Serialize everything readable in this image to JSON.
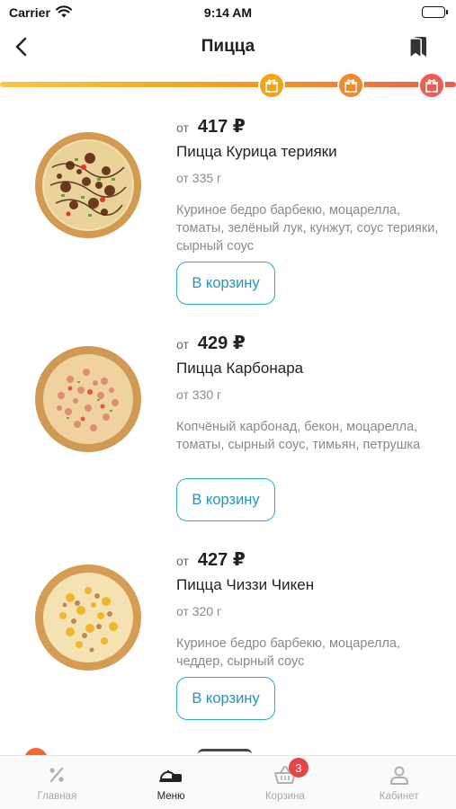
{
  "status_bar": {
    "carrier": "Carrier",
    "time": "9:14 AM"
  },
  "nav": {
    "title": "Пицца",
    "back_icon": "chevron-left-icon",
    "bookmark_icon": "bookmark-icon"
  },
  "gift_progress": {
    "gift_icon": "gift-icon",
    "colors": [
      "#f5a21b",
      "#f2892a",
      "#ee5d52"
    ]
  },
  "products": [
    {
      "price_prefix": "от",
      "price": "417 ₽",
      "name": "Пицца Курица терияки",
      "weight": "от 335 г",
      "ingredients": "Куриное бедро барбекю, моцарелла, томаты, зелёный лук, кунжут, соус терияки, сырный соус",
      "button": "В корзину"
    },
    {
      "price_prefix": "от",
      "price": "429 ₽",
      "name": "Пицца Карбонара",
      "weight": "от 330 г",
      "ingredients": "Копчёный карбонад, бекон, моцарелла, томаты, сырный соус, тимьян, петрушка",
      "button": "В корзину"
    },
    {
      "price_prefix": "от",
      "price": "427 ₽",
      "name": "Пицца Чиззи Чикен",
      "weight": "от 320 г",
      "ingredients": "Куриное бедро барбекю, моцарелла, чеддер, сырный соус",
      "button": "В корзину"
    }
  ],
  "tabs": [
    {
      "label": "Главная",
      "icon": "percent-icon",
      "active": false
    },
    {
      "label": "Меню",
      "icon": "menu-cloche-icon",
      "active": true
    },
    {
      "label": "Корзина",
      "icon": "basket-icon",
      "active": false,
      "badge": "3"
    },
    {
      "label": "Кабинет",
      "icon": "user-icon",
      "active": false
    }
  ],
  "colors": {
    "accent": "#1e97c2",
    "badge": "#e64545",
    "progress_start": "#f7c64a",
    "progress_end": "#ec5a4a"
  }
}
